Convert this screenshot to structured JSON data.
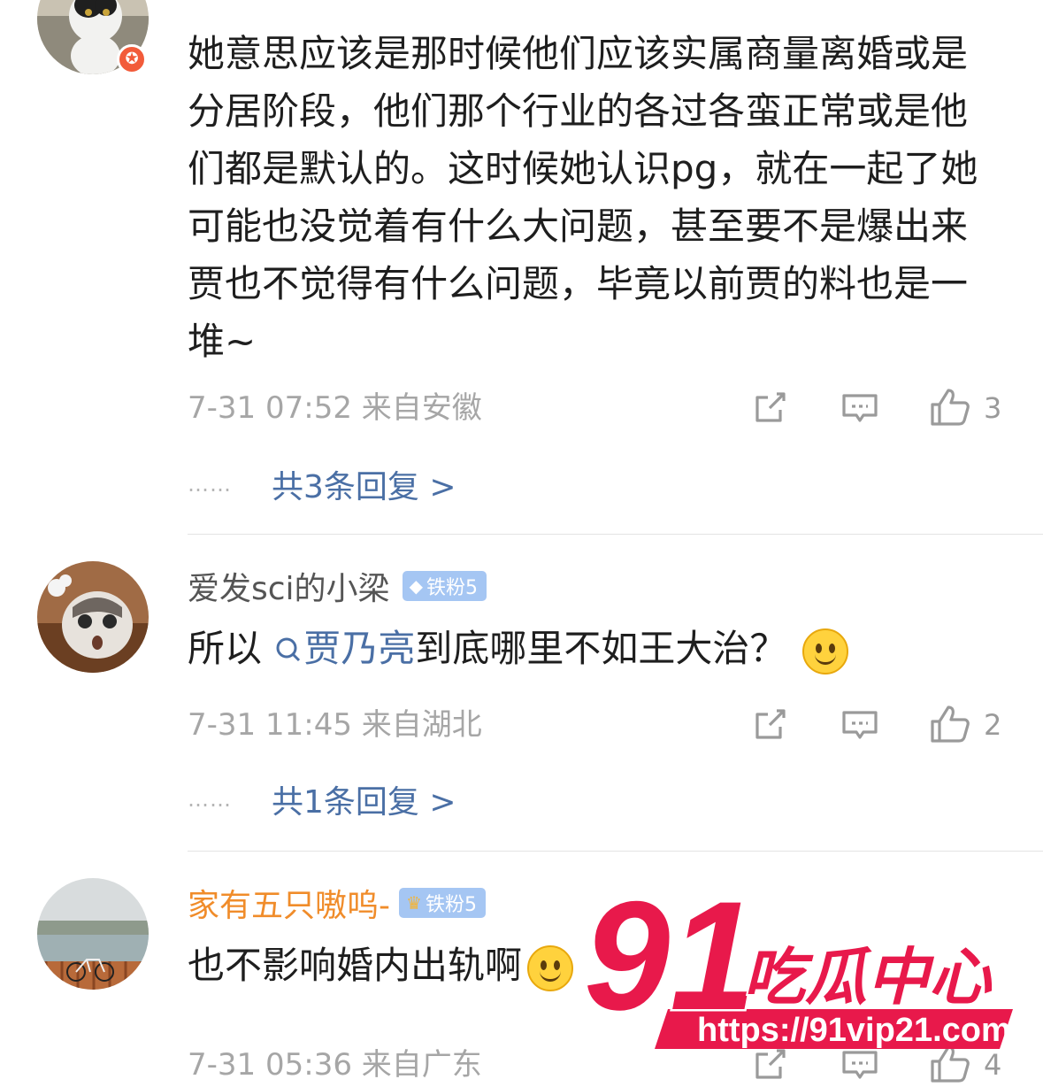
{
  "comments": [
    {
      "username": "",
      "fan_badge": "",
      "body": "她意思应该是那时候他们应该实属商量离婚或是分居阶段，他们那个行业的各过各蛮正常或是他们都是默认的。这时候她认识pg，就在一起了她可能也没觉着有什么大问题，甚至要不是爆出来贾也不觉得有什么问题，毕竟以前贾的料也是一堆~",
      "meta": "7-31 07:52  来自安徽",
      "likes": "3",
      "replies": "共3条回复 >"
    },
    {
      "username": "爱发sci的小梁",
      "fan_badge": "铁粉5",
      "body_prefix": "所以 ",
      "topic": "贾乃亮",
      "body_suffix": "到底哪里不如王大治？",
      "meta": "7-31 11:45  来自湖北",
      "likes": "2",
      "replies": "共1条回复 >"
    },
    {
      "username": "家有五只嗷呜-",
      "fan_badge": "铁粉5",
      "body": "也不影响婚内出轨啊",
      "meta": "7-31 05:36  来自广东",
      "likes": "4"
    }
  ],
  "ui": {
    "dots": "……"
  },
  "watermark": {
    "number": "91",
    "brand": "吃瓜中心",
    "url": "https://91vip21.com"
  },
  "colors": {
    "link_blue": "#4a6fa5",
    "meta_gray": "#a6a6a6",
    "orange_name": "#f08c2a",
    "watermark_red": "#e8194b"
  }
}
